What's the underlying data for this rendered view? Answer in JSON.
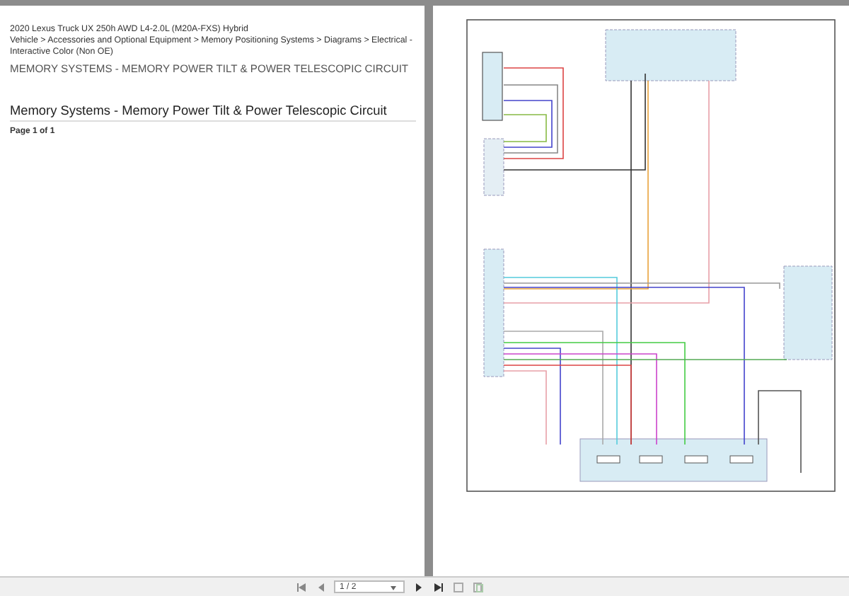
{
  "left_page": {
    "vehicle": "2020 Lexus Truck UX 250h AWD L4-2.0L (M20A-FXS) Hybrid",
    "breadcrumb": "Vehicle > Accessories and Optional Equipment > Memory Positioning Systems > Diagrams > Electrical - Interactive Color (Non OE)",
    "heading": "MEMORY SYSTEMS - MEMORY POWER TILT & POWER TELESCOPIC CIRCUIT",
    "title": "Memory Systems - Memory Power Tilt & Power Telescopic Circuit",
    "page_label": "Page 1 of 1"
  },
  "toolbar": {
    "page_field": "1 / 2"
  }
}
